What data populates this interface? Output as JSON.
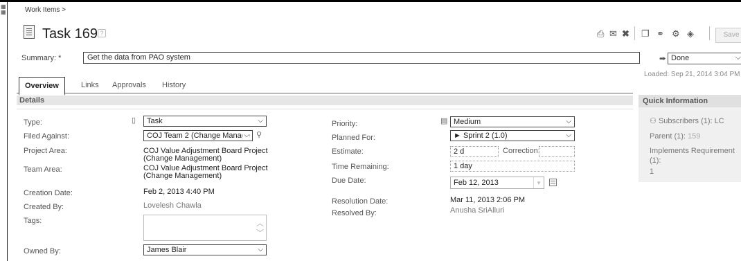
{
  "breadcrumb": "Work Items >",
  "title": "Task 169",
  "help_icon": "?",
  "toolbar": {
    "icons": [
      "print-icon",
      "email-icon",
      "delete-icon",
      "copy-icon",
      "link-icon",
      "settings-icon",
      "tag-icon"
    ],
    "save_label": "Save"
  },
  "summary": {
    "label": "Summary: *",
    "value": "Get the data from PAO system"
  },
  "state": {
    "value": "Done"
  },
  "loaded": "Loaded: Sep 21, 2014 3:04 PM",
  "tabs": [
    "Overview",
    "Links",
    "Approvals",
    "History"
  ],
  "details_header": "Details",
  "fields_left": {
    "type": {
      "label": "Type:",
      "value": "Task"
    },
    "filed_against": {
      "label": "Filed Against:",
      "value": "COJ Team 2 (Change Manage"
    },
    "project_area": {
      "label": "Project Area:",
      "line1": "COJ Value Adjustment Board Project",
      "line2": "(Change Management)"
    },
    "team_area": {
      "label": "Team Area:",
      "line1": "COJ Value Adjustment Board Project",
      "line2": "(Change Management)"
    },
    "creation_date": {
      "label": "Creation Date:",
      "value": "Feb 2, 2013 4:40 PM"
    },
    "created_by": {
      "label": "Created By:",
      "value": "Lovelesh Chawla"
    },
    "tags": {
      "label": "Tags:"
    },
    "owned_by": {
      "label": "Owned By:",
      "value": "James Blair"
    }
  },
  "fields_right": {
    "priority": {
      "label": "Priority:",
      "value": "Medium"
    },
    "planned_for": {
      "label": "Planned For:",
      "value": "► Sprint 2 (1.0)"
    },
    "estimate": {
      "label": "Estimate:",
      "value": "2 d",
      "correction_label": "Correction:"
    },
    "time_remaining": {
      "label": "Time Remaining:",
      "value": "1 day"
    },
    "due_date": {
      "label": "Due Date:",
      "value": "Feb 12, 2013"
    },
    "resolution_date": {
      "label": "Resolution Date:",
      "value": "Mar 11, 2013 2:06 PM"
    },
    "resolved_by": {
      "label": "Resolved By:",
      "value": "Anusha SriAlluri"
    }
  },
  "quick_info": {
    "header": "Quick Information",
    "subscribers": "Subscribers (1): LC",
    "parent_label": "Parent (1):",
    "parent_value": "159",
    "implements_line1": "Implements Requirement",
    "implements_line2": "(1):",
    "implements_value": "1"
  }
}
